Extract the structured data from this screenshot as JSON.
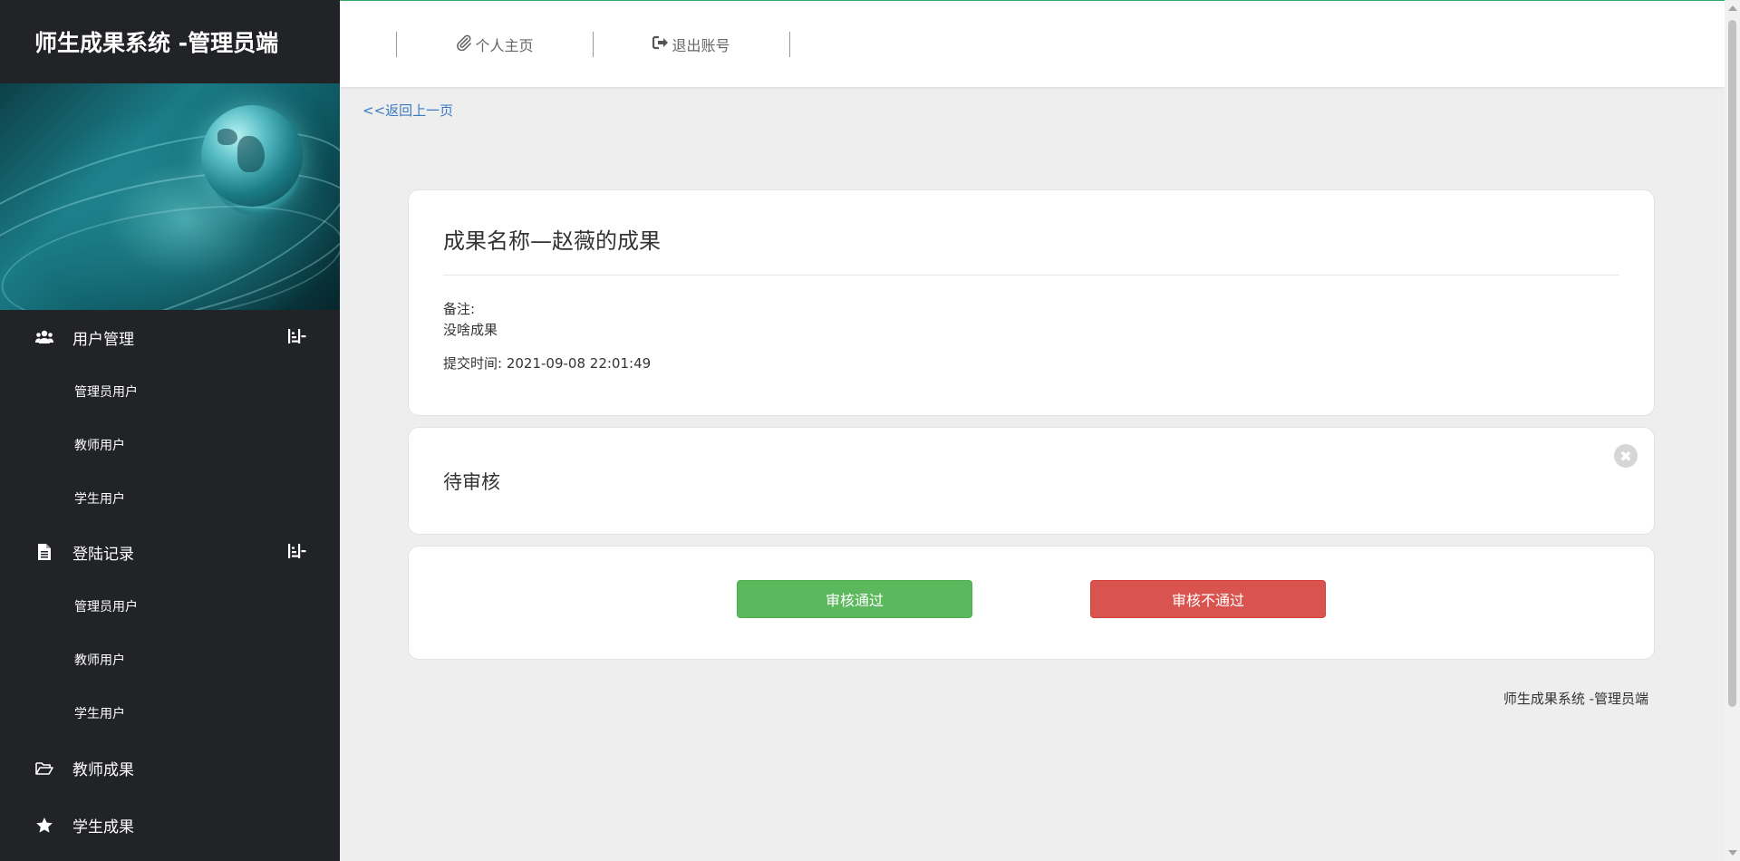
{
  "sidebar": {
    "brand": "师生成果系统 -管理员端",
    "groups": [
      {
        "label": "用户管理",
        "icon": "users-icon",
        "items": [
          {
            "label": "管理员用户"
          },
          {
            "label": "教师用户"
          },
          {
            "label": "学生用户"
          }
        ]
      },
      {
        "label": "登陆记录",
        "icon": "file-icon",
        "items": [
          {
            "label": "管理员用户"
          },
          {
            "label": "教师用户"
          },
          {
            "label": "学生用户"
          }
        ]
      }
    ],
    "singles": [
      {
        "label": "教师成果",
        "icon": "folder-open-icon"
      },
      {
        "label": "学生成果",
        "icon": "star-icon"
      }
    ]
  },
  "topnav": {
    "home_label": "个人主页",
    "home_icon": "paperclip-icon",
    "logout_label": "退出账号",
    "logout_icon": "sign-out-icon"
  },
  "content": {
    "back_link": "<<返回上一页",
    "achievement": {
      "title": "成果名称—赵薇的成果",
      "remark_label": "备注:",
      "remark": "没啥成果",
      "time_label": "提交时间:",
      "time": "2021-09-08 22:01:49"
    },
    "status": {
      "text": "待审核",
      "close_icon": "close-icon"
    },
    "actions": {
      "approve_label": "审核通过",
      "reject_label": "审核不通过"
    },
    "footer": "师生成果系统 -管理员端"
  },
  "colors": {
    "sidebar_bg": "#222326",
    "approve": "#5cb85c",
    "reject": "#d9534f",
    "link": "#3a7bc0"
  }
}
